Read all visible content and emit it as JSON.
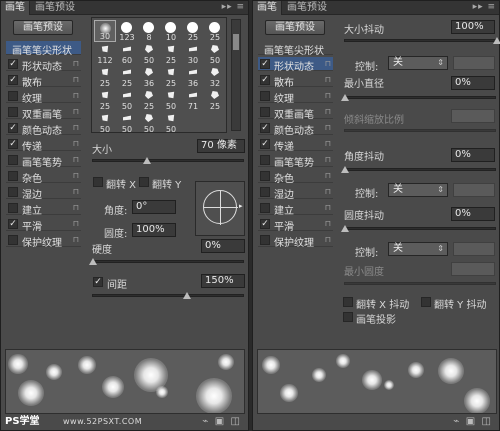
{
  "left": {
    "tabs": [
      "画笔",
      "画笔预设"
    ],
    "tab_controls": "▸▸ ≡",
    "preset_button": "画笔预设",
    "sidebar_header": "画笔笔尖形状",
    "sidebar": [
      {
        "label": "形状动态",
        "checked": true
      },
      {
        "label": "散布",
        "checked": true
      },
      {
        "label": "纹理",
        "checked": false
      },
      {
        "label": "双重画笔",
        "checked": false
      },
      {
        "label": "颜色动态",
        "checked": true
      },
      {
        "label": "传递",
        "checked": true
      },
      {
        "label": "画笔笔势",
        "checked": false
      },
      {
        "label": "杂色",
        "checked": false
      },
      {
        "label": "湿边",
        "checked": false
      },
      {
        "label": "建立",
        "checked": false
      },
      {
        "label": "平滑",
        "checked": true
      },
      {
        "label": "保护纹理",
        "checked": false
      }
    ],
    "brushes": [
      "30",
      "123",
      "8",
      "10",
      "25",
      "25",
      "112",
      "60",
      "50",
      "25",
      "30",
      "50",
      "25",
      "25",
      "36",
      "25",
      "36",
      "32",
      "25",
      "50",
      "25",
      "50",
      "71",
      "25",
      "50",
      "50",
      "50",
      "50"
    ],
    "size_label": "大小",
    "size_value": "70 像素",
    "flip_x": "翻转 X",
    "flip_y": "翻转 Y",
    "angle_label": "角度:",
    "angle_value": "0°",
    "roundness_label": "圆度:",
    "roundness_value": "100%",
    "hardness_label": "硬度",
    "hardness_value": "0%",
    "spacing_label": "间距",
    "spacing_value": "150%",
    "watermark": "PS学堂",
    "watermark_url": "www.52PSXT.COM"
  },
  "right": {
    "tabs": [
      "画笔",
      "画笔预设"
    ],
    "tab_controls": "▸▸ ≡",
    "preset_button": "画笔预设",
    "sidebar_header": "画笔笔尖形状",
    "sidebar": [
      {
        "label": "形状动态",
        "checked": true
      },
      {
        "label": "散布",
        "checked": true
      },
      {
        "label": "纹理",
        "checked": false
      },
      {
        "label": "双重画笔",
        "checked": false
      },
      {
        "label": "颜色动态",
        "checked": true
      },
      {
        "label": "传递",
        "checked": true
      },
      {
        "label": "画笔笔势",
        "checked": false
      },
      {
        "label": "杂色",
        "checked": false
      },
      {
        "label": "湿边",
        "checked": false
      },
      {
        "label": "建立",
        "checked": false
      },
      {
        "label": "平滑",
        "checked": true
      },
      {
        "label": "保护纹理",
        "checked": false
      }
    ],
    "size_jitter_label": "大小抖动",
    "size_jitter_value": "100%",
    "control_label": "控制:",
    "control_value": "关",
    "min_diameter_label": "最小直径",
    "min_diameter_value": "0%",
    "tilt_scale_label": "倾斜缩放比例",
    "angle_jitter_label": "角度抖动",
    "angle_jitter_value": "0%",
    "roundness_jitter_label": "圆度抖动",
    "roundness_jitter_value": "0%",
    "min_roundness_label": "最小圆度",
    "flip_x_jitter": "翻转 X 抖动",
    "flip_y_jitter": "翻转 Y 抖动",
    "brush_projection": "画笔投影"
  }
}
